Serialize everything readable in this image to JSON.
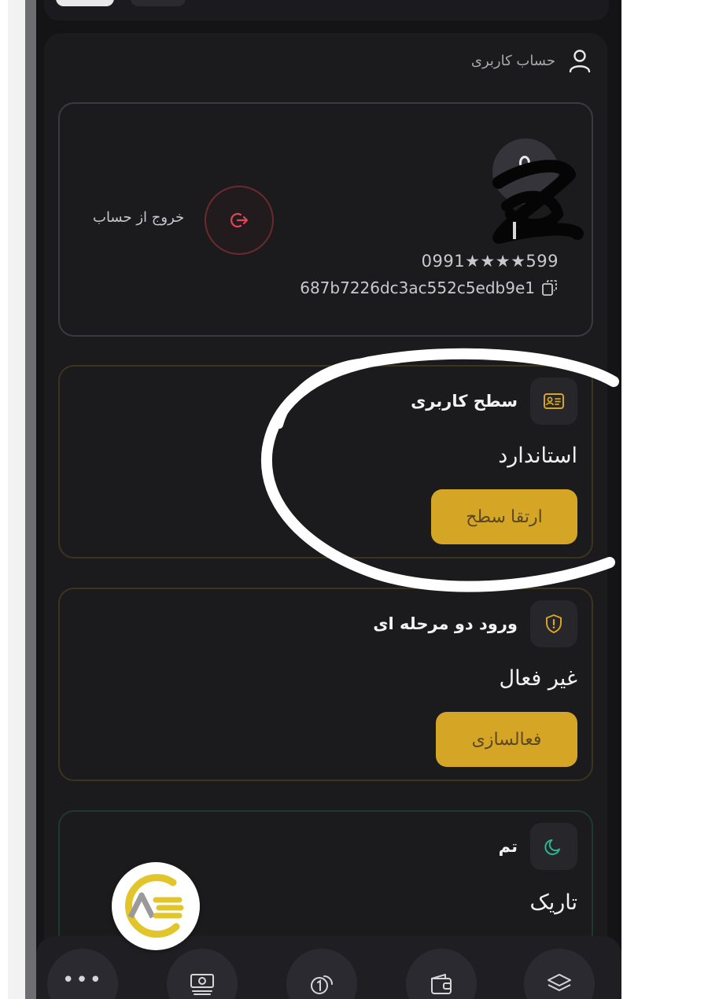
{
  "header": {
    "title": "حساب کاربری"
  },
  "profile": {
    "phone": "0991★★★★599",
    "user_id": "687b7226dc3ac552c5edb9e1",
    "logout_label": "خروج از حساب"
  },
  "level_card": {
    "title": "سطح کاربری",
    "value": "استاندارد",
    "button_label": "ارتقا سطح"
  },
  "twofa_card": {
    "title": "ورود دو مرحله ای",
    "value": "غیر فعال",
    "button_label": "فعالسازی"
  },
  "theme_card": {
    "title": "تم",
    "value": "تاریک"
  },
  "bottom_nav": {
    "more_label": "•••",
    "items": [
      "more-icon",
      "money-icon",
      "coin-icon",
      "wallet-icon",
      "layers-icon"
    ]
  },
  "colors": {
    "accent_gold": "#d5a526",
    "logout_red": "#e0455a",
    "theme_teal": "#2bb592",
    "background": "#141417"
  }
}
